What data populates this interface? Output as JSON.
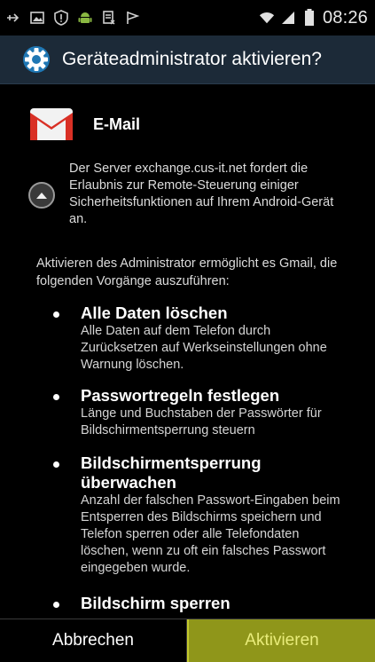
{
  "status_bar": {
    "time": "08:26",
    "left_icons": [
      "usb-icon",
      "image-icon",
      "alert-icon",
      "android-icon",
      "document-icon",
      "flag-icon"
    ],
    "right_icons": [
      "wifi-icon",
      "signal-icon",
      "battery-icon"
    ]
  },
  "title_bar": {
    "title": "Geräteadministrator aktivieren?",
    "icon": "settings-icon",
    "accent": "#1f77b4"
  },
  "app": {
    "name": "E-Mail",
    "icon": "gmail-icon"
  },
  "server_message": "Der Server exchange.cus-it.net fordert die Erlaubnis zur Remote-Steuerung einiger Sicherheitsfunktionen auf Ihrem Android-Gerät an.",
  "intro": "Aktivieren des Administrator ermöglicht es Gmail, die folgenden Vorgänge auszuführen:",
  "permissions": [
    {
      "title": "Alle Daten löschen",
      "description": "Alle Daten auf dem Telefon durch Zurücksetzen auf Werkseinstellungen ohne Warnung löschen."
    },
    {
      "title": "Passwortregeln festlegen",
      "description": "Länge und Buchstaben der Passwörter für Bildschirmentsperrung steuern"
    },
    {
      "title": "Bildschirmentsperrung überwachen",
      "description": "Anzahl der falschen Passwort-Eingaben beim Entsperren des Bildschirms speichern und Telefon sperren oder alle Telefondaten löschen, wenn zu oft ein falsches Passwort eingegeben wurde."
    },
    {
      "title": "Bildschirm sperren",
      "description": ""
    }
  ],
  "buttons": {
    "cancel": "Abbrechen",
    "activate": "Aktivieren",
    "activate_color": "#8f961a"
  }
}
